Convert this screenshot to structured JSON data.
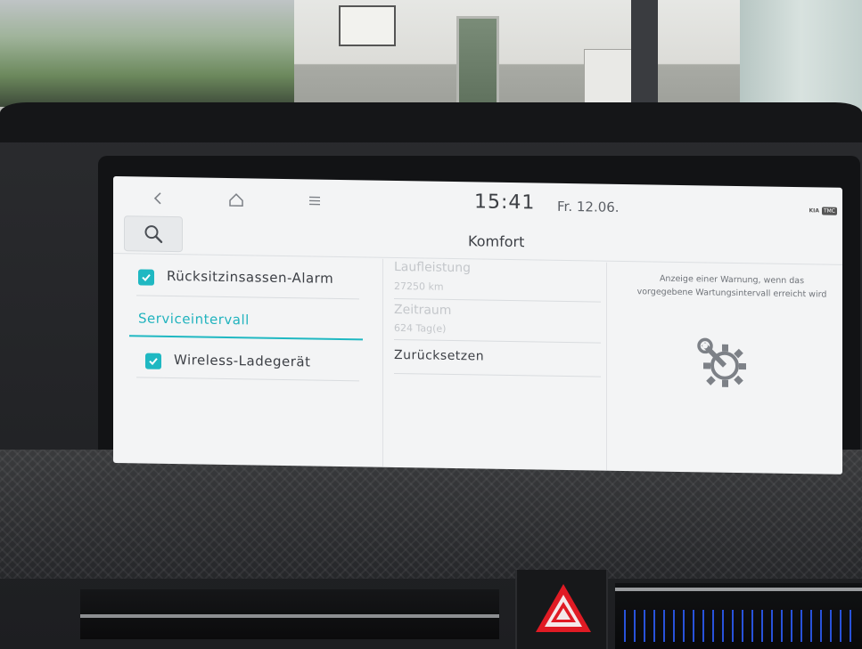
{
  "screen": {
    "nav": {
      "back_icon": "chevron-left-icon",
      "home_icon": "home-icon",
      "menu_icon": "hamburger-menu-icon"
    },
    "time": "15:41",
    "date": "Fr. 12.06.",
    "status": {
      "brand": "KIA",
      "badge": "TMC"
    },
    "search_icon": "search-icon",
    "title": "Komfort",
    "left_menu": [
      {
        "label": "Rücksitzinsassen-Alarm",
        "checked": true
      },
      {
        "label": "Serviceintervall",
        "selected": true
      },
      {
        "label": "Wireless-Ladegerät",
        "checked": true
      }
    ],
    "details": {
      "mileage_title": "Laufleistung",
      "mileage_value": "27250 km",
      "period_title": "Zeitraum",
      "period_value": "624 Tag(e)",
      "reset_label": "Zurücksetzen"
    },
    "help_text": "Anzeige einer Warnung, wenn das vorgegebene Wartungsintervall erreicht wird",
    "help_icon": "wrench-gear-icon"
  },
  "colors": {
    "accent": "#1fb8c2",
    "screen_bg": "#f3f4f5",
    "text": "#3d4046",
    "disabled_text": "#c4c7cb",
    "hazard": "#e01b24"
  },
  "dashboard": {
    "hazard_icon": "hazard-warning-icon"
  }
}
